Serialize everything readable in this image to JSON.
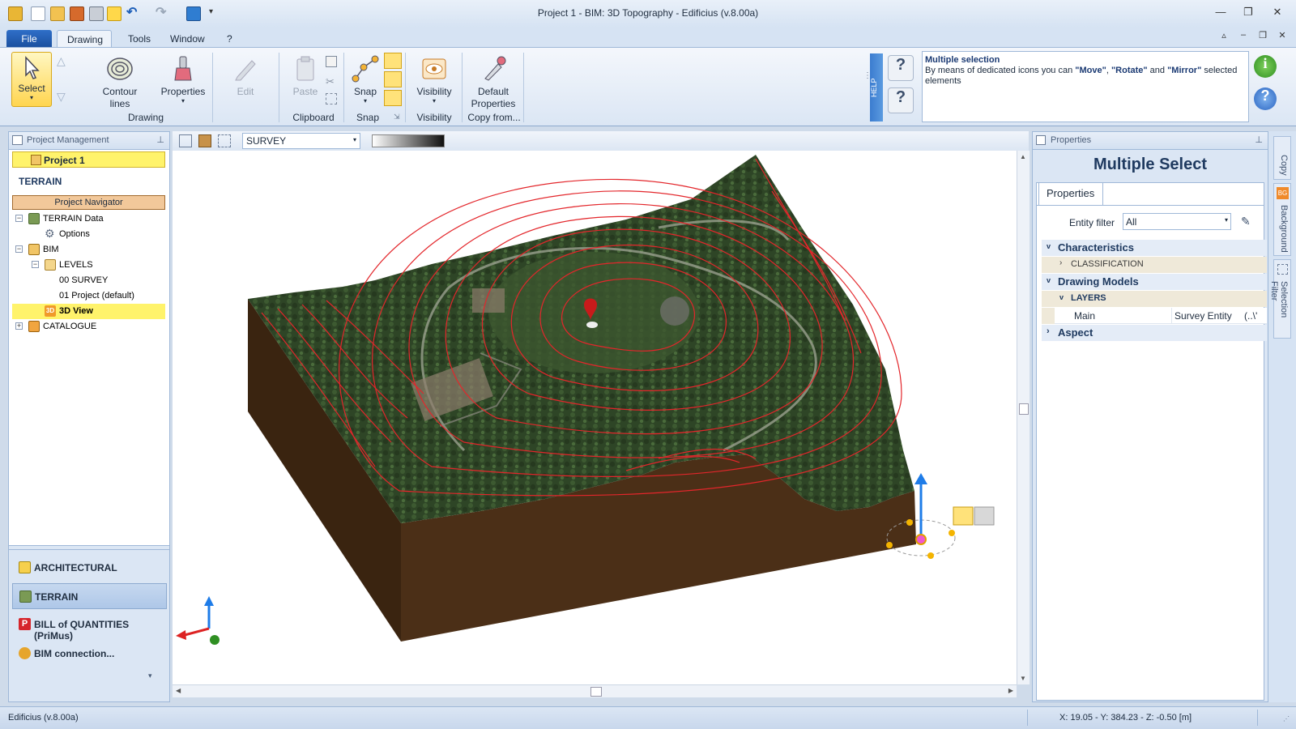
{
  "window": {
    "title": "Project 1 -  BIM: 3D Topography - Edificius (v.8.00a)"
  },
  "menu_tabs": [
    "File",
    "Drawing",
    "Tools",
    "Window",
    "?"
  ],
  "ribbon": {
    "select_label": "Select",
    "contour_lines_label": "Contour lines",
    "properties_label": "Properties",
    "edit_label": "Edit",
    "paste_label": "Paste",
    "snap_label": "Snap",
    "visibility_label": "Visibility",
    "default_properties_label": "Default Properties",
    "groups": {
      "drawing": "Drawing",
      "clipboard": "Clipboard",
      "snap": "Snap",
      "visibility": "Visibility",
      "copy_from": "Copy from..."
    },
    "help_tab": "HELP",
    "help_title": "Multiple selection",
    "help_text_1": "By means of dedicated icons you can ",
    "help_move": "\"Move\"",
    "help_sep1": ", ",
    "help_rotate": "\"Rotate\"",
    "help_and": " and ",
    "help_mirror": "\"Mirror\"",
    "help_text_2": " selected elements"
  },
  "project_panel": {
    "header": "Project Management",
    "project_name": "Project 1",
    "section_title": "TERRAIN",
    "navigator_label": "Project Navigator",
    "tree": [
      {
        "label": "TERRAIN Data",
        "level": 0,
        "toggle": "−"
      },
      {
        "label": "Options",
        "level": 1,
        "toggle": ""
      },
      {
        "label": "BIM",
        "level": 0,
        "toggle": "−"
      },
      {
        "label": "LEVELS",
        "level": 1,
        "toggle": "−"
      },
      {
        "label": "00 SURVEY",
        "level": 2,
        "toggle": ""
      },
      {
        "label": "01 Project (default)",
        "level": 2,
        "toggle": ""
      },
      {
        "label": "3D View",
        "level": 2,
        "toggle": "",
        "selected": true
      },
      {
        "label": "CATALOGUE",
        "level": 0,
        "toggle": "+"
      }
    ],
    "sections": [
      "ARCHITECTURAL",
      "TERRAIN",
      "BILL of QUANTITIES (PriMus)",
      "BIM connection..."
    ]
  },
  "viewport_toolbar": {
    "level_select": "SURVEY"
  },
  "properties_panel": {
    "header": "Properties",
    "title": "Multiple Select",
    "tab": "Properties",
    "entity_filter_label": "Entity filter",
    "entity_filter_value": "All",
    "groups": {
      "characteristics": "Characteristics",
      "classification": "CLASSIFICATION",
      "drawing_models": "Drawing Models",
      "layers": "LAYERS",
      "layer_name": "Main",
      "layer_value": "Survey Entity",
      "layer_more": "(..\\'",
      "aspect": "Aspect"
    }
  },
  "side_tabs": [
    "Copy",
    "Background",
    "Selection Filter"
  ],
  "status": {
    "app": "Edificius (v.8.00a)",
    "coords": "X: 19.05 - Y: 384.23 - Z: -0.50 [m]"
  },
  "colors": {
    "accent": "#1a4f9e",
    "selection": "#fff36b",
    "contour": "#e3262b",
    "soil": "#4b2f17"
  }
}
